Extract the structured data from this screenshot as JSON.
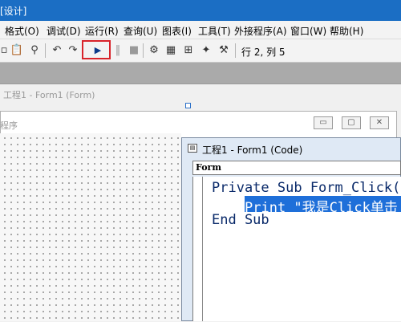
{
  "window": {
    "title": "[设计]"
  },
  "menu": [
    "格式(O)",
    "调试(D)",
    "运行(R)",
    "查询(U)",
    "图表(I)",
    "工具(T)",
    "外接程序(A)",
    "窗口(W)",
    "帮助(H)"
  ],
  "toolbar": {
    "status": "行 2, 列 5"
  },
  "designer": {
    "title": "工程1 - Form1 (Form)"
  },
  "form": {
    "title_fragment": "程序"
  },
  "code_window": {
    "title": "工程1 - Form1 (Code)",
    "object_combo": "Form",
    "lines": [
      "Private Sub Form_Click(",
      "Print \"我是Click单击",
      "End Sub"
    ]
  },
  "colors": {
    "title_bar": "#1b6ec4",
    "highlight": "#1e6fd9",
    "run_outline": "#d8232a"
  }
}
